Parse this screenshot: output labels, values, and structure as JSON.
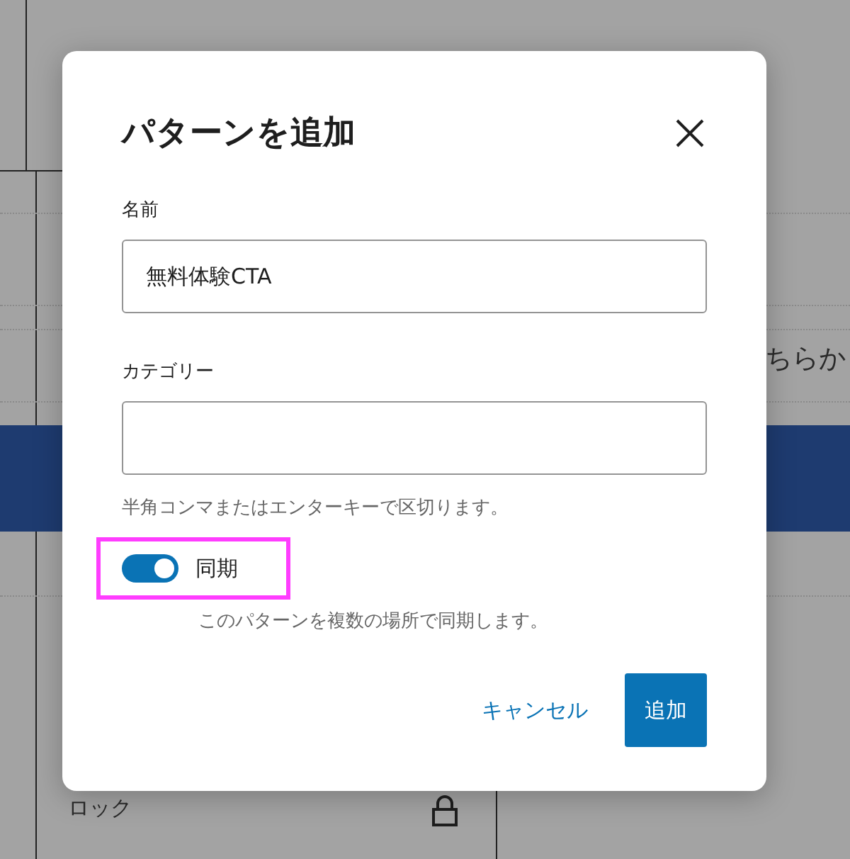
{
  "background": {
    "side_text": "ちらか",
    "lock_label": "ロック"
  },
  "dialog": {
    "title": "パターンを追加",
    "fields": [
      {
        "label": "名前",
        "value": "無料体験CTA"
      },
      {
        "label": "カテゴリー",
        "help": "半角コンマまたはエンターキーで区切ります。"
      }
    ],
    "sync": {
      "label": "同期",
      "on": true,
      "highlighted": true,
      "description": "このパターンを複数の場所で同期します。"
    },
    "buttons": [
      {
        "label": "キャンセル",
        "kind": "link"
      },
      {
        "label": "追加",
        "kind": "primary"
      }
    ]
  }
}
